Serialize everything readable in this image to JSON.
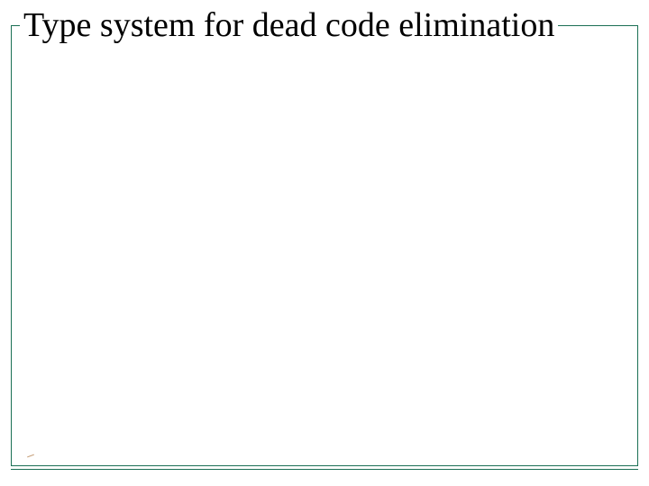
{
  "slide": {
    "title": "Type system for dead code elimination"
  },
  "colors": {
    "frame": "#1a6f54",
    "text": "#000000",
    "background": "#ffffff"
  }
}
